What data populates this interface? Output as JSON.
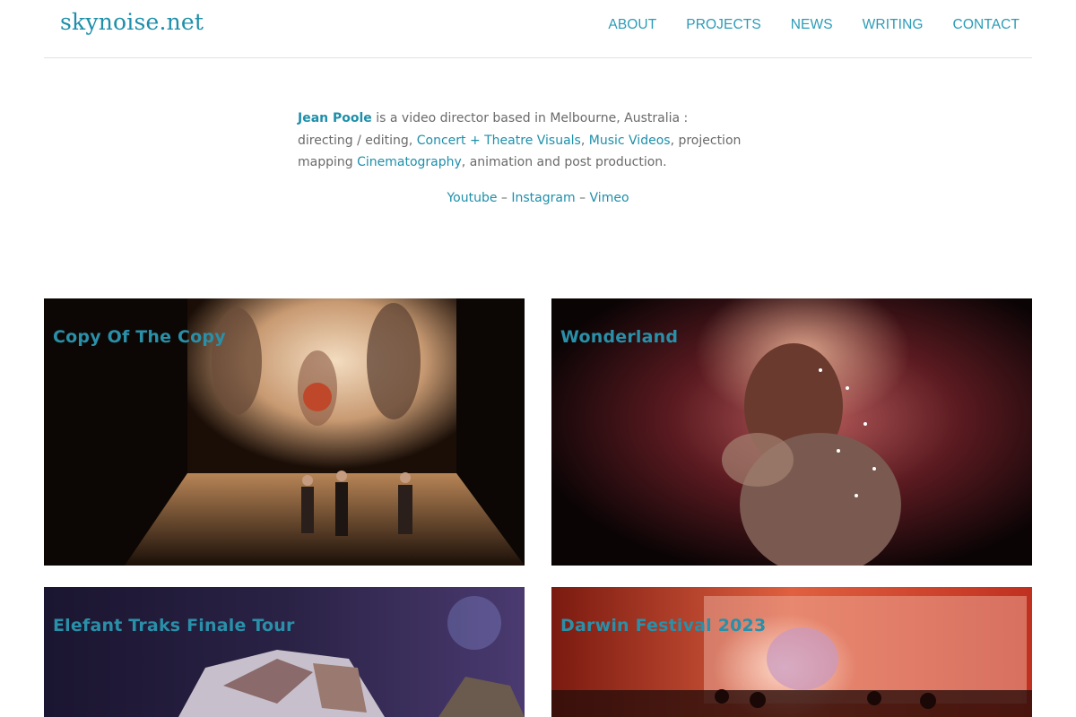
{
  "header": {
    "site_title": "skynoise.net",
    "nav": [
      "ABOUT",
      "PROJECTS",
      "NEWS",
      "WRITING",
      "CONTACT"
    ]
  },
  "intro": {
    "name": "Jean Poole",
    "text1": " is a video director based in Melbourne, Australia : directing / editing, ",
    "link1": "Concert + Theatre Visuals",
    "sep1": ",  ",
    "link2": "Music Videos",
    "text2": ", projection mapping ",
    "link3": "Cinematography",
    "text3": ", animation and post production."
  },
  "social": {
    "youtube": "Youtube",
    "sep": " – ",
    "instagram": "Instagram",
    "vimeo": "Vimeo"
  },
  "projects": [
    {
      "title": "Copy Of The Copy"
    },
    {
      "title": "Wonderland"
    },
    {
      "title": "Elefant Traks Finale Tour"
    },
    {
      "title": "Darwin Festival 2023"
    }
  ],
  "colors": {
    "link": "#1e8faa",
    "text": "#6a6a6a",
    "divider": "#e2e2e2"
  }
}
